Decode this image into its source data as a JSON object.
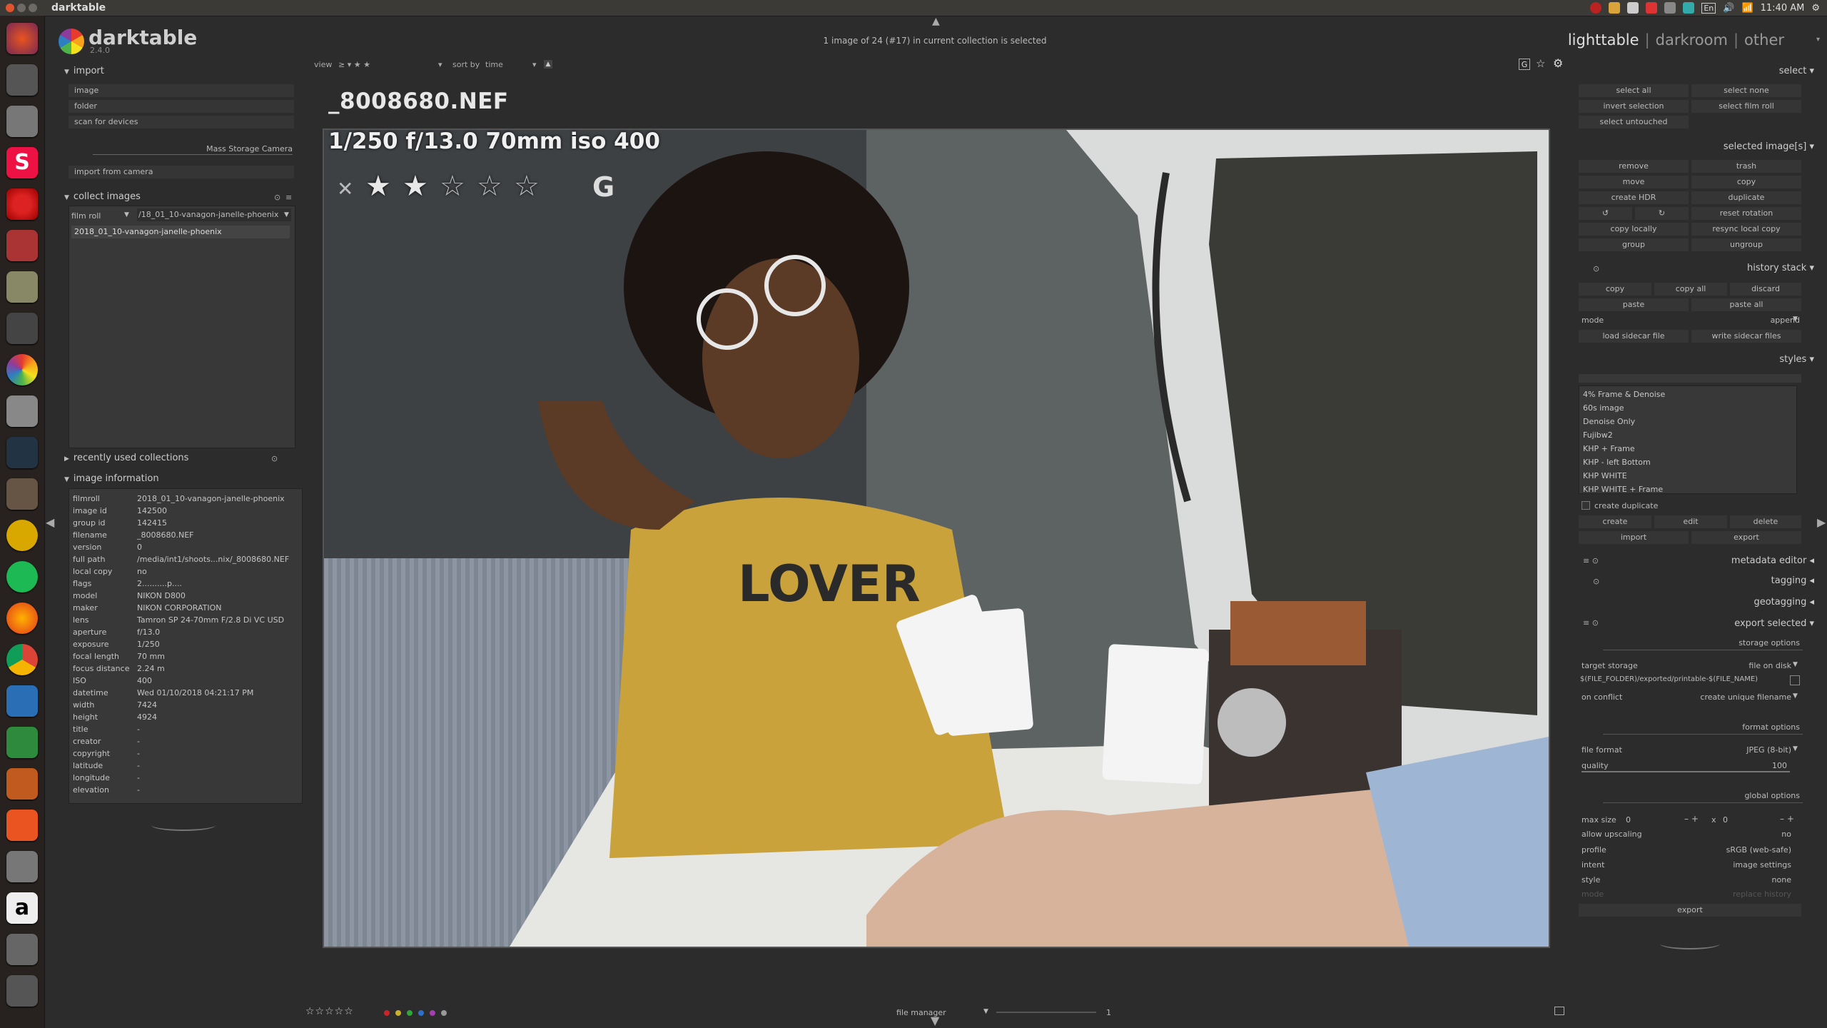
{
  "system": {
    "window_title": "darktable",
    "time": "11:40 AM",
    "keyboard": "En"
  },
  "app": {
    "name": "darktable",
    "version": "2.4.0",
    "collection_status": "1 image of 24 (#17) in current collection is selected",
    "views": {
      "lighttable": "lighttable",
      "darkroom": "darkroom",
      "other": "other",
      "sep": "|"
    }
  },
  "toolbar": {
    "view_label": "view",
    "view_filter": "≥ ▾ ★ ★",
    "sort_by_label": "sort by",
    "sort_value": "time"
  },
  "left": {
    "import": {
      "title": "import",
      "buttons": [
        "image",
        "folder",
        "scan for devices"
      ],
      "device": "Mass Storage Camera",
      "import_from_camera": "import from camera"
    },
    "collect": {
      "title": "collect images",
      "rule_label": "film roll",
      "rule_value": "/18_01_10-vanagon-janelle-phoenix",
      "list": [
        "2018_01_10-vanagon-janelle-phoenix"
      ]
    },
    "recent": {
      "title": "recently used collections"
    },
    "info": {
      "title": "image information",
      "rows": [
        {
          "k": "filmroll",
          "v": "2018_01_10-vanagon-janelle-phoenix"
        },
        {
          "k": "image id",
          "v": "142500"
        },
        {
          "k": "group id",
          "v": "142415"
        },
        {
          "k": "filename",
          "v": "_8008680.NEF"
        },
        {
          "k": "version",
          "v": "0"
        },
        {
          "k": "full path",
          "v": "/media/int1/shoots...nix/_8008680.NEF"
        },
        {
          "k": "local copy",
          "v": "no"
        },
        {
          "k": "flags",
          "v": "2..........p...."
        },
        {
          "k": "model",
          "v": "NIKON D800"
        },
        {
          "k": "maker",
          "v": "NIKON CORPORATION"
        },
        {
          "k": "lens",
          "v": "Tamron SP 24-70mm F/2.8 Di VC USD"
        },
        {
          "k": "aperture",
          "v": "f/13.0"
        },
        {
          "k": "exposure",
          "v": "1/250"
        },
        {
          "k": "focal length",
          "v": "70 mm"
        },
        {
          "k": "focus distance",
          "v": "2.24 m"
        },
        {
          "k": "ISO",
          "v": "400"
        },
        {
          "k": "datetime",
          "v": "Wed 01/10/2018 04:21:17 PM"
        },
        {
          "k": "width",
          "v": "7424"
        },
        {
          "k": "height",
          "v": "4924"
        },
        {
          "k": "title",
          "v": "-"
        },
        {
          "k": "creator",
          "v": "-"
        },
        {
          "k": "copyright",
          "v": "-"
        },
        {
          "k": "latitude",
          "v": "-"
        },
        {
          "k": "longitude",
          "v": "-"
        },
        {
          "k": "elevation",
          "v": "-"
        }
      ]
    }
  },
  "center": {
    "filename": "_8008680.NEF",
    "exif_overlay": "1/250 f/13.0 70mm iso 400",
    "reject_glyph": "✕",
    "group_badge": "G",
    "rating": 2,
    "shirt_text": "LOVER"
  },
  "right": {
    "select": {
      "title": "select",
      "buttons": [
        "select all",
        "select none",
        "invert selection",
        "select film roll",
        "select untouched"
      ]
    },
    "selected": {
      "title": "selected image[s]",
      "buttons": [
        "remove",
        "trash",
        "move",
        "copy",
        "create HDR",
        "duplicate",
        "reset rotation",
        "copy locally",
        "resync local copy",
        "group",
        "ungroup"
      ]
    },
    "history": {
      "title": "history stack",
      "buttons": [
        "copy",
        "copy all",
        "discard",
        "paste",
        "paste all",
        "load sidecar file",
        "write sidecar files"
      ],
      "mode_label": "mode",
      "mode_value": "append"
    },
    "styles": {
      "title": "styles",
      "items": [
        "4% Frame & Denoise",
        "60s image",
        "Denoise Only",
        "Fujibw2",
        "KHP + Frame",
        "KHP - left Bottom",
        "KHP WHITE",
        "KHP WHITE + Frame"
      ],
      "create_duplicate": "create duplicate",
      "buttons": [
        "create",
        "edit",
        "delete",
        "import",
        "export"
      ]
    },
    "collapsed": [
      "metadata editor",
      "tagging",
      "geotagging"
    ],
    "export": {
      "title": "export selected",
      "storage_options": "storage options",
      "target_storage_label": "target storage",
      "target_storage_value": "file on disk",
      "path": "$(FILE_FOLDER)/exported/printable-$(FILE_NAME)",
      "on_conflict_label": "on conflict",
      "on_conflict_value": "create unique filename",
      "format_options": "format options",
      "file_format_label": "file format",
      "file_format_value": "JPEG (8-bit)",
      "quality_label": "quality",
      "quality_value": "100",
      "global_options": "global options",
      "max_size_label": "max size",
      "max_w": "0",
      "max_x": "x",
      "max_h": "0",
      "upscaling_label": "allow upscaling",
      "upscaling_value": "no",
      "profile_label": "profile",
      "profile_value": "sRGB (web-safe)",
      "intent_label": "intent",
      "intent_value": "image settings",
      "style_label": "style",
      "style_value": "none",
      "mode_label": "mode",
      "mode_value": "replace history",
      "export_button": "export"
    }
  },
  "bottom": {
    "stars": "☆☆☆☆☆",
    "layout": "file manager",
    "zoom": "1",
    "colors": [
      "#c8252a",
      "#c8b12a",
      "#2fa53a",
      "#2f6fc8",
      "#a33fb0",
      "#999999"
    ]
  }
}
